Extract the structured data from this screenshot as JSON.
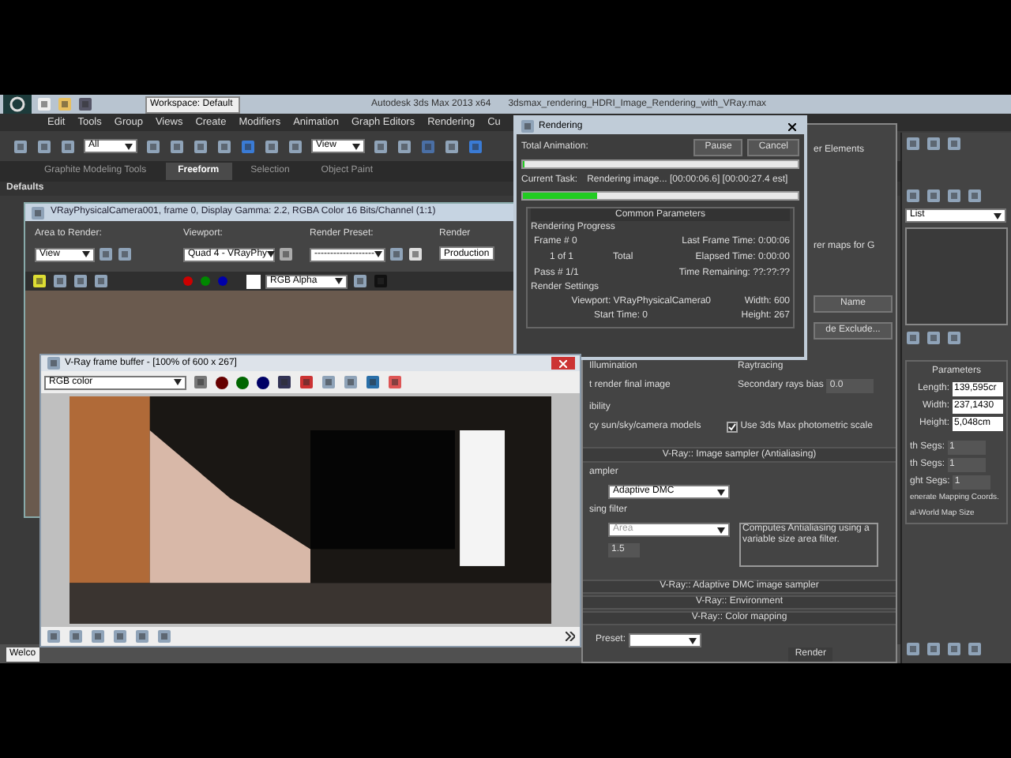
{
  "main_window": {
    "workspace": "Workspace: Default",
    "title_app": "Autodesk 3ds Max 2013 x64",
    "title_file": "3dsmax_rendering_HDRI_Image_Rendering_with_VRay.max"
  },
  "menu": [
    "Edit",
    "Tools",
    "Group",
    "Views",
    "Create",
    "Modifiers",
    "Animation",
    "Graph Editors",
    "Rendering",
    "Cu"
  ],
  "toolbar": {
    "selection_filter": "All",
    "reference_coord": "View"
  },
  "ribbon_tabs": [
    {
      "label": "Graphite Modeling Tools",
      "selected": false
    },
    {
      "label": "Freeform",
      "selected": true
    },
    {
      "label": "Selection",
      "selected": false
    },
    {
      "label": "Object Paint",
      "selected": false
    }
  ],
  "ribbon_panel": "Defaults",
  "render_frame": {
    "title": "VRayPhysicalCamera001, frame 0, Display Gamma: 2.2, RGBA Color 16 Bits/Channel (1:1)",
    "area_label": "Area to Render:",
    "area_value": "View",
    "viewport_label": "Viewport:",
    "viewport_value": "Quad 4 - VRayPhy",
    "preset_label": "Render Preset:",
    "preset_value": "-------------------",
    "render_label": "Render",
    "render_value": "Production",
    "channel": "RGB Alpha"
  },
  "vfb": {
    "title": "V-Ray frame buffer - [100% of 600 x 267]",
    "channel": "RGB color"
  },
  "rendering_dialog": {
    "title": "Rendering",
    "total_label": "Total Animation:",
    "total_progress": {
      "level": 0
    },
    "pause": "Pause",
    "cancel": "Cancel",
    "task_label": "Current Task:",
    "task": "Rendering image... [00:00:06.6] [00:00:27.4 est]",
    "task_progress": {
      "level": 0.27
    },
    "section": "Common Parameters",
    "progress_group": "Rendering Progress",
    "frame": "Frame #  0",
    "of": "1 of 1",
    "total": "Total",
    "pass": "Pass #  1/1",
    "last_frame": "Last Frame Time:  0:00:06",
    "elapsed": "Elapsed Time:  0:00:00",
    "remaining": "Time Remaining:  ??:??:??",
    "settings_group": "Render Settings",
    "viewport": "Viewport:  VRayPhysicalCamera0",
    "start": "Start Time:  0",
    "width": "Width:  600",
    "height": "Height:  267"
  },
  "render_setup": {
    "tab": "er Elements",
    "maps": "rer maps for G",
    "name_button": "Name",
    "exclude_button": "de Exclude...",
    "gi_group": "Illumination",
    "gi_text": "t render final image",
    "ray_group": "Raytracing",
    "bias_label": "Secondary rays bias",
    "bias_value": "0.0",
    "compat_group": "ibility",
    "compat_text": "cy sun/sky/camera models",
    "photometric": {
      "label": "Use 3ds Max photometric scale",
      "checked": true
    },
    "sampler_rollout": "V-Ray:: Image sampler (Antialiasing)",
    "sampler_group": "ampler",
    "sampler_value": "Adaptive DMC",
    "filter_group": "sing filter",
    "filter_value": "Area",
    "filter_disabled": true,
    "size_value": "1.5",
    "description": "Computes Antialiasing using a variable size area filter.",
    "rollouts": [
      "V-Ray:: Adaptive DMC image sampler",
      "V-Ray:: Environment",
      "V-Ray:: Color mapping"
    ],
    "preset_label": "Preset:",
    "render_label": "Render"
  },
  "command_panel": {
    "list": "List",
    "rollout": "Parameters",
    "fields": [
      {
        "label": "Length:",
        "value": "139,595cr"
      },
      {
        "label": "Width:",
        "value": "237,1430"
      },
      {
        "label": "Height:",
        "value": "5,048cm"
      }
    ],
    "segs": [
      {
        "label": "th Segs:",
        "value": "1"
      },
      {
        "label": "th Segs:",
        "value": "1"
      },
      {
        "label": "ght Segs:",
        "value": "1"
      }
    ],
    "options": [
      "enerate Mapping Coords.",
      "al-World Map Size"
    ]
  },
  "status": "Welco"
}
